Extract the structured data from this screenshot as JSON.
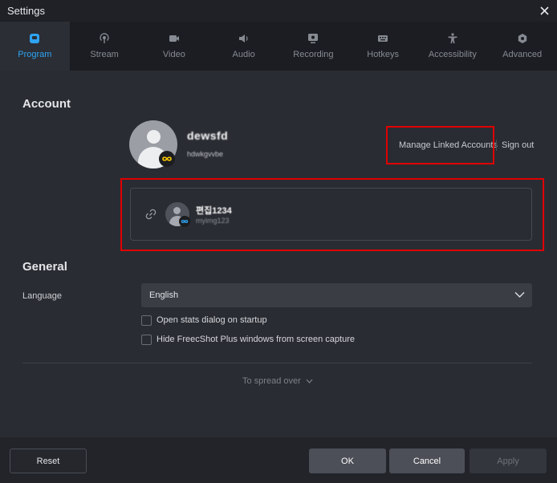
{
  "window": {
    "title": "Settings"
  },
  "tabs": [
    {
      "label": "Program",
      "icon": "program-icon",
      "active": true
    },
    {
      "label": "Stream",
      "icon": "stream-icon",
      "active": false
    },
    {
      "label": "Video",
      "icon": "video-icon",
      "active": false
    },
    {
      "label": "Audio",
      "icon": "audio-icon",
      "active": false
    },
    {
      "label": "Recording",
      "icon": "recording-icon",
      "active": false
    },
    {
      "label": "Hotkeys",
      "icon": "hotkeys-icon",
      "active": false
    },
    {
      "label": "Accessibility",
      "icon": "accessibility-icon",
      "active": false
    },
    {
      "label": "Advanced",
      "icon": "advanced-icon",
      "active": false
    }
  ],
  "account": {
    "heading": "Account",
    "username": "dewsfd",
    "user_id": "hdwkgvvbe",
    "manage_label": "Manage Linked Accounts",
    "signout_label": "Sign out",
    "linked": {
      "name": "편집1234",
      "id": "myimg123"
    }
  },
  "general": {
    "heading": "General",
    "language_label": "Language",
    "language_value": "English",
    "options": [
      {
        "label": "Open stats dialog on startup",
        "checked": false
      },
      {
        "label": "Hide FreecShot Plus windows from screen capture",
        "checked": false
      }
    ],
    "expand_label": "To spread over"
  },
  "footer": {
    "reset": "Reset",
    "ok": "OK",
    "cancel": "Cancel",
    "apply": "Apply"
  },
  "colors": {
    "accent": "#2ea3f2",
    "highlight_box": "#e00000",
    "badge": "#f5c400"
  }
}
